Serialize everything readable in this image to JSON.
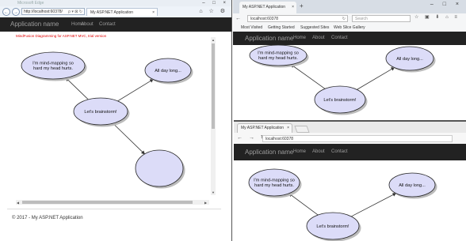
{
  "ie_window": {
    "title": "Microsoft Edge",
    "address": "http://localhost:60378/",
    "address_controls": "ρ ▾ ⊠ ↻",
    "tab_label": "My ASP.NET Application",
    "tab_close": "×",
    "window_controls": "– □ ×",
    "toolbar_icons": "⌂ ☆ ⚙",
    "back_glyph": "←",
    "forward_glyph": "→",
    "navbar": {
      "brand": "Application name",
      "links": [
        "Home",
        "About",
        "Contact"
      ]
    },
    "trial_notice": "MindFusion Diagramming for ASP.NET MVC, trial version",
    "footer": "© 2017 - My ASP.NET Application",
    "scroll_arrows": {
      "up": "▲",
      "down": "▼",
      "left": "◀",
      "right": "▶"
    }
  },
  "firefox_window": {
    "tab_label": "My ASP.NET Application",
    "tab_close": "×",
    "new_tab": "+",
    "window_controls": "– □ ×",
    "nav_glyphs": "← ⓘ",
    "url": "localhost:60378",
    "url_reload": "↻",
    "search_placeholder": "Search",
    "toolbar_icons": "☆ ▣ ⬇ ⌂ ≡",
    "bookmarks": [
      "Most Visited",
      "Getting Started",
      "Suggested Sites",
      "Web Slice Gallery"
    ],
    "navbar": {
      "brand": "Application name",
      "links": [
        "Home",
        "About",
        "Contact"
      ]
    }
  },
  "chrome_window": {
    "tab_label": "My ASP.NET Application",
    "tab_close": "×",
    "nav_glyphs": "← → ↻",
    "url": "localhost:60378",
    "navbar": {
      "brand": "Application name",
      "links": [
        "Home",
        "About",
        "Contact"
      ]
    }
  },
  "diagram": {
    "nodes": {
      "center": "Let's brainstorm!",
      "top_left": "I'm mind-mapping so hard my head hurts.",
      "top_right": "All day long...",
      "bottom_right": ""
    },
    "colors": {
      "node_fill": "#dcdcf8",
      "node_stroke": "#222222",
      "link": "#333333",
      "shadow": "#bbbbbb"
    }
  },
  "colors": {
    "navbar_bg": "#222222",
    "navbar_text": "#9d9d9d",
    "trial_text": "#e00000"
  }
}
